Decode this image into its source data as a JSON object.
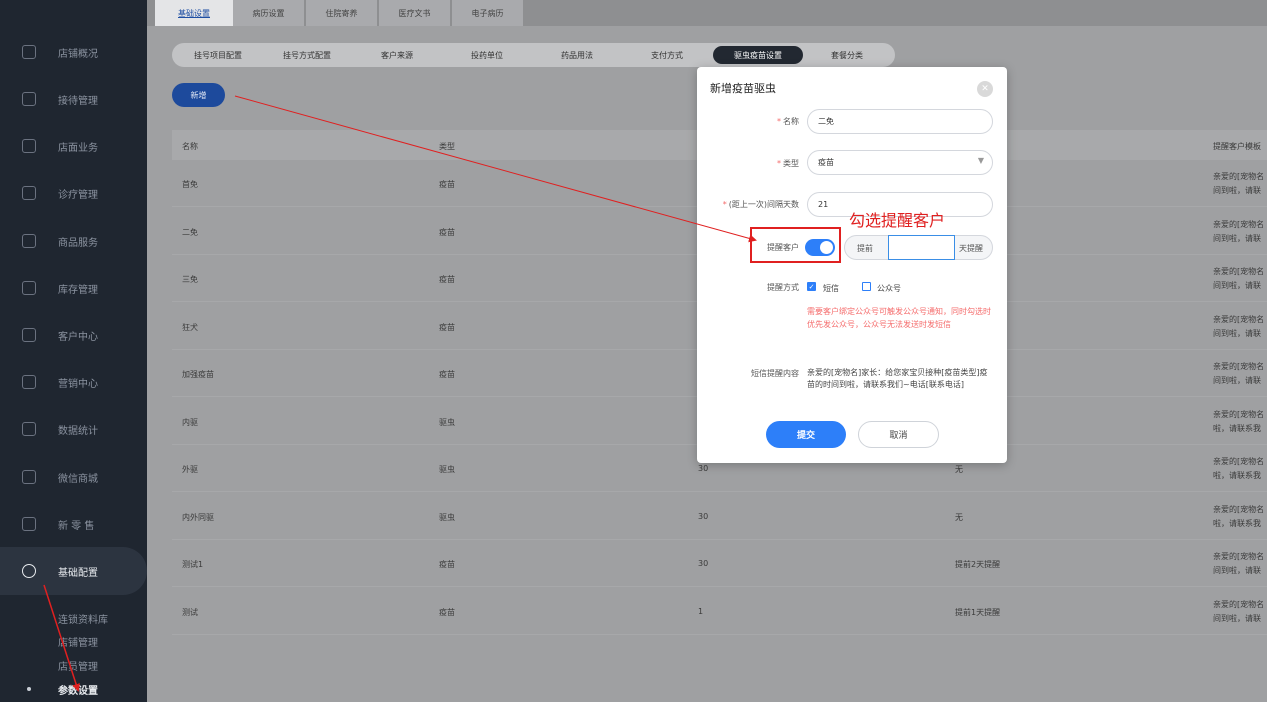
{
  "sidebar": {
    "items": [
      {
        "label": "店铺概况",
        "icon": "monitor-icon"
      },
      {
        "label": "接待管理",
        "icon": "reception-icon"
      },
      {
        "label": "店面业务",
        "icon": "store-icon"
      },
      {
        "label": "诊疗管理",
        "icon": "medical-icon"
      },
      {
        "label": "商品服务",
        "icon": "goods-icon"
      },
      {
        "label": "库存管理",
        "icon": "inventory-icon"
      },
      {
        "label": "客户中心",
        "icon": "customer-icon"
      },
      {
        "label": "营销中心",
        "icon": "marketing-icon"
      },
      {
        "label": "数据统计",
        "icon": "chart-icon"
      },
      {
        "label": "微信商城",
        "icon": "wechat-icon"
      },
      {
        "label": "新 零 售",
        "icon": "retail-icon"
      },
      {
        "label": "基础配置",
        "icon": "settings-icon"
      }
    ],
    "sub_items": [
      "连锁资料库",
      "店铺管理",
      "店员管理",
      "参数设置"
    ]
  },
  "top_tabs": [
    "基础设置",
    "病历设置",
    "住院寄养",
    "医疗文书",
    "电子病历"
  ],
  "sub_tabs": [
    "挂号项目配置",
    "挂号方式配置",
    "客户来源",
    "投药单位",
    "药品用法",
    "支付方式",
    "驱虫疫苗设置",
    "套餐分类"
  ],
  "add_button": "新增",
  "table": {
    "headers": [
      "名称",
      "类型",
      "提醒客户模板"
    ],
    "rows": [
      {
        "name": "首免",
        "type": "疫苗",
        "days": "",
        "remind": "",
        "template": [
          "亲爱的[宠物名",
          "间到啦，请联"
        ]
      },
      {
        "name": "二免",
        "type": "疫苗",
        "days": "",
        "remind": "",
        "template": [
          "亲爱的[宠物名",
          "间到啦，请联"
        ]
      },
      {
        "name": "三免",
        "type": "疫苗",
        "days": "",
        "remind": "",
        "template": [
          "亲爱的[宠物名",
          "间到啦，请联"
        ]
      },
      {
        "name": "狂犬",
        "type": "疫苗",
        "days": "",
        "remind": "",
        "template": [
          "亲爱的[宠物名",
          "间到啦，请联"
        ]
      },
      {
        "name": "加强疫苗",
        "type": "疫苗",
        "days": "",
        "remind": "",
        "template": [
          "亲爱的[宠物名",
          "间到啦，请联"
        ]
      },
      {
        "name": "内驱",
        "type": "驱虫",
        "days": "",
        "remind": "",
        "template": [
          "亲爱的[宠物名",
          "啦，请联系我"
        ]
      },
      {
        "name": "外驱",
        "type": "驱虫",
        "days": "30",
        "remind": "无",
        "template": [
          "亲爱的[宠物名",
          "啦，请联系我"
        ]
      },
      {
        "name": "内外同驱",
        "type": "驱虫",
        "days": "30",
        "remind": "无",
        "template": [
          "亲爱的[宠物名",
          "啦，请联系我"
        ]
      },
      {
        "name": "测试1",
        "type": "疫苗",
        "days": "30",
        "remind": "提前2天提醒",
        "template": [
          "亲爱的[宠物名",
          "间到啦，请联"
        ]
      },
      {
        "name": "测试",
        "type": "疫苗",
        "days": "1",
        "remind": "提前1天提醒",
        "template": [
          "亲爱的[宠物名",
          "间到啦，请联"
        ]
      }
    ]
  },
  "modal": {
    "title": "新增疫苗驱虫",
    "close_icon": "close-icon",
    "name_label": "名称",
    "name_value": "二免",
    "type_label": "类型",
    "type_value": "疫苗",
    "days_label": "(距上一次)间隔天数",
    "days_value": "21",
    "remind_label": "提醒客户",
    "remind_enabled": true,
    "remind_prefix": "提前",
    "remind_days_value": "",
    "remind_suffix": "天提醒",
    "method_label": "提醒方式",
    "method_sms": "短信",
    "method_sms_checked": true,
    "method_wechat": "公众号",
    "method_wechat_checked": false,
    "warning": "需要客户绑定公众号可触发公众号通知，同时勾选时优先发公众号，公众号无法发送时发短信",
    "sms_label": "短信提醒内容",
    "sms_content": "亲爱的[宠物名]家长：给您家宝贝接种[疫苗类型]疫苗的时间到啦，请联系我们~电话[联系电话]",
    "submit": "提交",
    "cancel": "取消"
  },
  "annotation": {
    "callout": "勾选提醒客户",
    "color": "#e02020"
  },
  "colors": {
    "sidebar_bg": "#1f2630",
    "primary": "#2d7ff9",
    "danger": "#f56c6c"
  }
}
